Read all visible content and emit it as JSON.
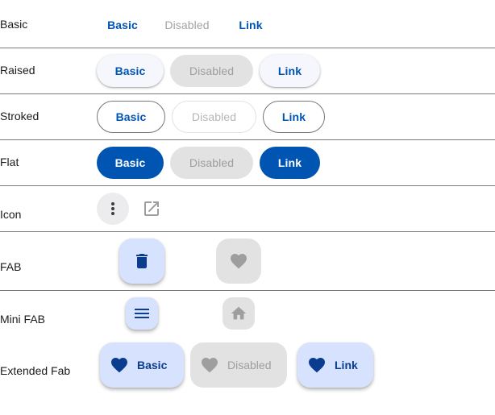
{
  "rows": {
    "basic": {
      "label": "Basic"
    },
    "raised": {
      "label": "Raised"
    },
    "stroked": {
      "label": "Stroked"
    },
    "flat": {
      "label": "Flat"
    },
    "icon": {
      "label": "Icon"
    },
    "fab": {
      "label": "FAB"
    },
    "mini_fab": {
      "label": "Mini FAB"
    },
    "extended_fab": {
      "label": "Extended Fab"
    }
  },
  "buttons": {
    "basic": "Basic",
    "disabled": "Disabled",
    "link": "Link"
  },
  "icons": {
    "icon_row": [
      "more-vert-icon",
      "open-in-new-icon"
    ],
    "fab_row": [
      "delete-icon",
      "favorite-icon"
    ],
    "mini_fab_row": [
      "menu-icon",
      "home-icon"
    ],
    "extended_fab_row": [
      "favorite-icon",
      "favorite-icon",
      "favorite-icon"
    ]
  },
  "colors": {
    "primary": "#0055b3",
    "fab_container": "#d7e2ff",
    "fab_icon": "#0a3d8f",
    "disabled_bg": "#e2e2e2",
    "disabled_text": "#9e9e9e"
  }
}
